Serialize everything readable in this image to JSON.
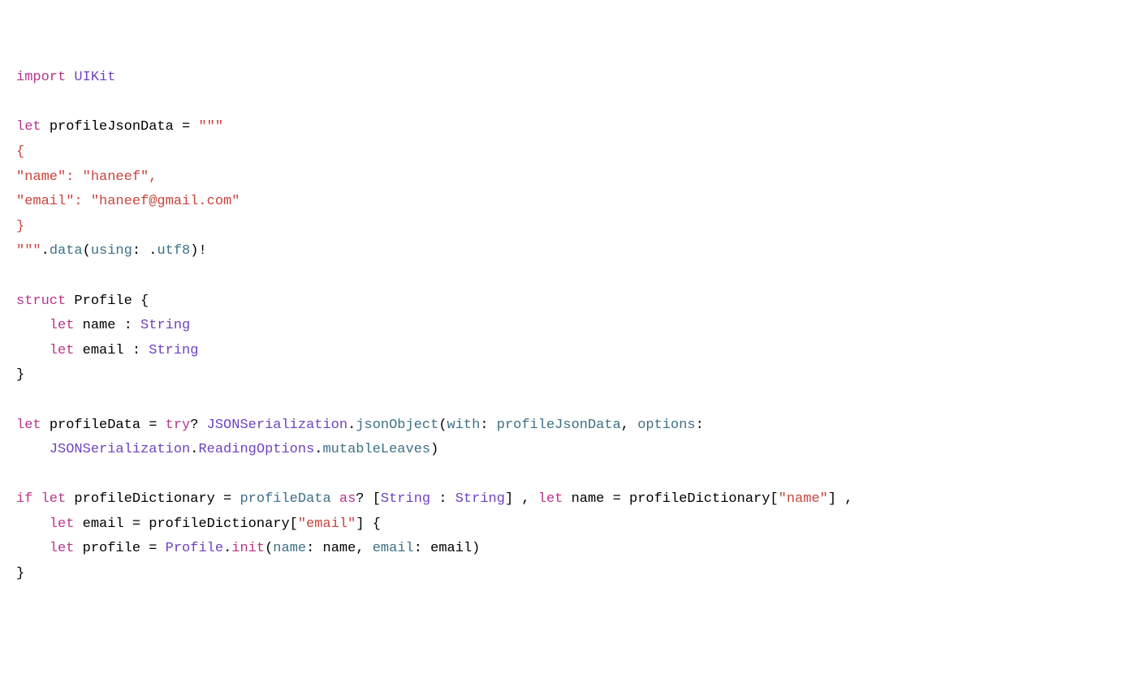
{
  "code": {
    "l01": {
      "kw_import": "import",
      "type_uikit": "UIKit"
    },
    "l03": {
      "kw_let": "let",
      "var": "profileJsonData",
      "eq": " = ",
      "str_open": "\"\"\""
    },
    "l04": "{",
    "l05": "\"name\": \"haneef\",",
    "l06": "\"email\": \"haneef@gmail.com\"",
    "l07": "}",
    "l08": {
      "str_close": "\"\"\"",
      "dot": ".",
      "fn_data": "data",
      "p_using": "using",
      "col": ": .",
      "utf8": "utf8",
      "tail": ")!"
    },
    "l10": {
      "kw_struct": "struct",
      "name": "Profile",
      "brace": " {"
    },
    "l11": {
      "kw_let": "let",
      "name": "name",
      "col": " : ",
      "type": "String"
    },
    "l12": {
      "kw_let": "let",
      "name": "email",
      "col": " : ",
      "type": "String"
    },
    "l13": "}",
    "l15": {
      "kw_let": "let",
      "var": "profileData",
      "eq": " = ",
      "kw_try": "try",
      "q": "? ",
      "type_js": "JSONSerialization",
      "dot": ".",
      "fn": "jsonObject",
      "op": "(",
      "p_with": "with",
      "col1": ": ",
      "arg1": "profileJsonData",
      "comma": ", ",
      "p_opt": "options",
      "col2": ":"
    },
    "l16": {
      "type_js": "JSONSerialization",
      "dot1": ".",
      "ro": "ReadingOptions",
      "dot2": ".",
      "ml": "mutableLeaves",
      "close": ")"
    },
    "l18": {
      "kw_if": "if",
      "kw_let1": "let",
      "var1": "profileDictionary",
      "eq1": " = ",
      "pd": "profileData",
      "kw_as": "as",
      "q": "? [",
      "t1": "String",
      "col": " : ",
      "t2": "String",
      "close1": "] , ",
      "kw_let2": "let",
      "var2": "name",
      "eq2": " = profileDictionary[",
      "str_name": "\"name\"",
      "close2": "] ,"
    },
    "l19": {
      "kw_let": "let",
      "var": "email",
      "eq": " = profileDictionary[",
      "str_email": "\"email\"",
      "close": "] {"
    },
    "l20": {
      "kw_let": "let",
      "var": "profile",
      "eq": " = ",
      "type": "Profile",
      "dot": ".",
      "init": "init",
      "op": "(",
      "p1": "name",
      "col1": ": name, ",
      "p2": "email",
      "col2": ": email)"
    },
    "l21": "}"
  }
}
